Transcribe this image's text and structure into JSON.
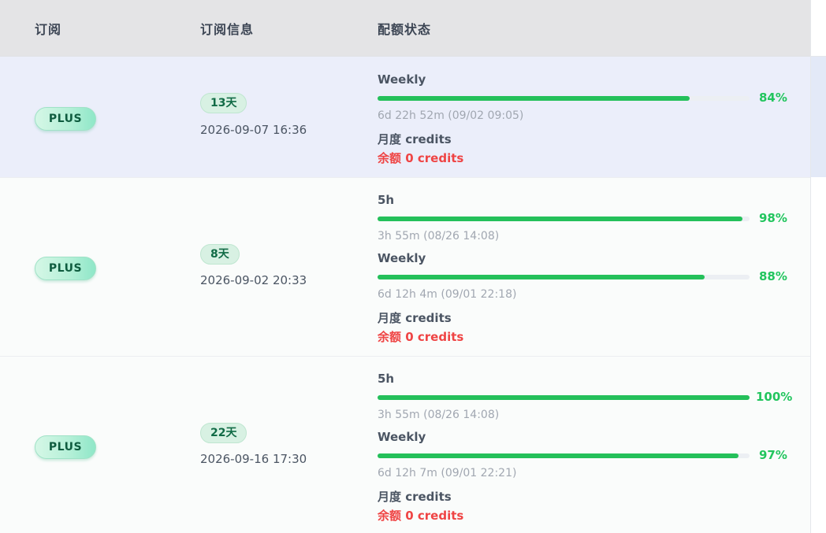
{
  "header": {
    "col_subscription": "订阅",
    "col_info": "订阅信息",
    "col_quota": "配额状态"
  },
  "colors": {
    "bar_fill": "#24c05a",
    "percent_text": "#22c55e",
    "credits_remaining": "#ef4444",
    "selected_row": "#ebeefa"
  },
  "rows": [
    {
      "plan": "PLUS",
      "days_left": "13天",
      "expiry": "2026-09-07 16:36",
      "quotas": [
        {
          "label": "Weekly",
          "percent_text": "84%",
          "percent": 84,
          "reset": "6d 22h 52m (09/02 09:05)"
        }
      ],
      "credits_label": "月度 credits",
      "credits_remaining": "余额 0 credits"
    },
    {
      "plan": "PLUS",
      "days_left": "8天",
      "expiry": "2026-09-02 20:33",
      "quotas": [
        {
          "label": "5h",
          "percent_text": "98%",
          "percent": 98,
          "reset": "3h 55m (08/26 14:08)"
        },
        {
          "label": "Weekly",
          "percent_text": "88%",
          "percent": 88,
          "reset": "6d 12h 4m (09/01 22:18)"
        }
      ],
      "credits_label": "月度 credits",
      "credits_remaining": "余额 0 credits"
    },
    {
      "plan": "PLUS",
      "days_left": "22天",
      "expiry": "2026-09-16 17:30",
      "quotas": [
        {
          "label": "5h",
          "percent_text": "100%",
          "percent": 100,
          "reset": "3h 55m (08/26 14:08)"
        },
        {
          "label": "Weekly",
          "percent_text": "97%",
          "percent": 97,
          "reset": "6d 12h 7m (09/01 22:21)"
        }
      ],
      "credits_label": "月度 credits",
      "credits_remaining": "余额 0 credits"
    }
  ]
}
